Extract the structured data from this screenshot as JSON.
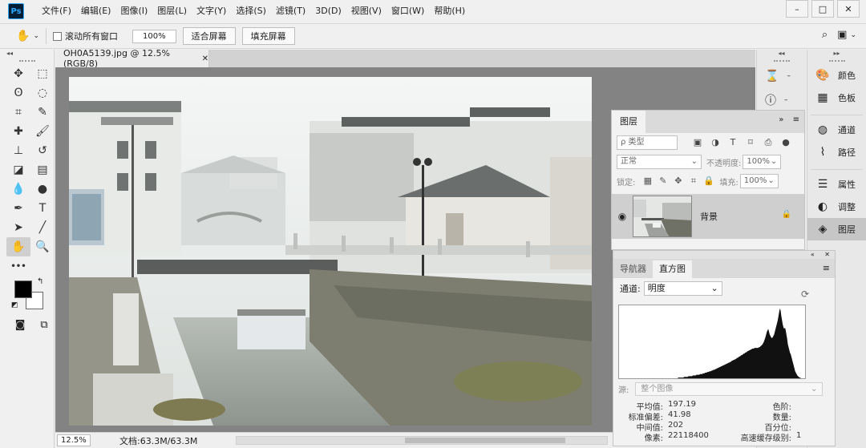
{
  "menubar": {
    "logo": "Ps",
    "items": [
      "文件(F)",
      "编辑(E)",
      "图像(I)",
      "图层(L)",
      "文字(Y)",
      "选择(S)",
      "滤镜(T)",
      "3D(D)",
      "视图(V)",
      "窗口(W)",
      "帮助(H)"
    ],
    "window_controls": [
      "–",
      "□",
      "✕"
    ]
  },
  "options": {
    "scroll_all_label": "滚动所有窗口",
    "zoom_value": "100%",
    "fit_screen_label": "适合屏幕",
    "fill_screen_label": "填充屏幕"
  },
  "document": {
    "tab_title": "OH0A5139.jpg @ 12.5%(RGB/8)",
    "tab_close": "✕",
    "status_zoom": "12.5%",
    "status_docinfo": "文档:63.3M/63.3M"
  },
  "tools": {
    "panel_collapse": "◂◂",
    "items": [
      {
        "name": "move-tool",
        "glyph": "✥"
      },
      {
        "name": "marquee-tool",
        "glyph": "⬚"
      },
      {
        "name": "lasso-tool",
        "glyph": "ʘ"
      },
      {
        "name": "quick-select-tool",
        "glyph": "◌"
      },
      {
        "name": "crop-tool",
        "glyph": "⌗"
      },
      {
        "name": "eyedropper-tool",
        "glyph": "✎"
      },
      {
        "name": "healing-tool",
        "glyph": "✚"
      },
      {
        "name": "brush-tool",
        "glyph": "🖌"
      },
      {
        "name": "stamp-tool",
        "glyph": "⊥"
      },
      {
        "name": "history-brush-tool",
        "glyph": "↺"
      },
      {
        "name": "eraser-tool",
        "glyph": "◪"
      },
      {
        "name": "gradient-tool",
        "glyph": "▤"
      },
      {
        "name": "blur-tool",
        "glyph": "💧"
      },
      {
        "name": "dodge-tool",
        "glyph": "●"
      },
      {
        "name": "pen-tool",
        "glyph": "✒"
      },
      {
        "name": "type-tool",
        "glyph": "T"
      },
      {
        "name": "path-select-tool",
        "glyph": "➤"
      },
      {
        "name": "line-tool",
        "glyph": "╱"
      },
      {
        "name": "hand-tool",
        "glyph": "✋"
      },
      {
        "name": "zoom-tool",
        "glyph": "🔍"
      },
      {
        "name": "more-tools",
        "glyph": "•••"
      },
      {
        "name": "empty-slot",
        "glyph": ""
      }
    ]
  },
  "dock1": {
    "collapse": "◂◂",
    "items": [
      {
        "name": "history-icon",
        "glyph": "⌛"
      },
      {
        "name": "info-icon",
        "glyph": "ⓘ"
      }
    ]
  },
  "dock2": {
    "collapse": "▸▸",
    "items": [
      {
        "name": "color",
        "label": "颜色",
        "glyph": "🎨"
      },
      {
        "name": "swatches",
        "label": "色板",
        "glyph": "▦"
      },
      {
        "name": "channels",
        "label": "通道",
        "glyph": "◍"
      },
      {
        "name": "paths",
        "label": "路径",
        "glyph": "⌇"
      },
      {
        "name": "properties",
        "label": "属性",
        "glyph": "☰"
      },
      {
        "name": "adjustments",
        "label": "调整",
        "glyph": "◐"
      },
      {
        "name": "layers",
        "label": "图层",
        "glyph": "◈"
      }
    ]
  },
  "layers_panel": {
    "tab_label": "图层",
    "filter_placeholder": "ρ 类型",
    "blend_mode": "正常",
    "opacity_label": "不透明度:",
    "opacity_value": "100%",
    "lock_label": "锁定:",
    "fill_label": "填充:",
    "fill_value": "100%",
    "layer_name": "背景"
  },
  "histogram_panel": {
    "tab_navigator": "导航器",
    "tab_histogram": "直方图",
    "channel_label": "通道:",
    "channel_value": "明度",
    "source_label": "源:",
    "source_value": "整个图像",
    "stats": {
      "mean_label": "平均值:",
      "mean_value": "197.19",
      "stddev_label": "标准偏差:",
      "stddev_value": "41.98",
      "median_label": "中间值:",
      "median_value": "202",
      "pixels_label": "像素:",
      "pixels_value": "22118400",
      "level_label": "色阶:",
      "level_value": "",
      "count_label": "数量:",
      "count_value": "",
      "percentile_label": "百分位:",
      "percentile_value": "",
      "cache_label": "高速缓存级别:",
      "cache_value": "1"
    },
    "histogram_bins": [
      0,
      0,
      0,
      0,
      0,
      0,
      0,
      0,
      0,
      0,
      0,
      0,
      0,
      0,
      0,
      0,
      0,
      0,
      0,
      0,
      0,
      0,
      0,
      0,
      0,
      0,
      0,
      0,
      0,
      0,
      0,
      0,
      0,
      0,
      0,
      0,
      0,
      0,
      0,
      0,
      0,
      0,
      0,
      0,
      0,
      0,
      0,
      0,
      0,
      0,
      0,
      0,
      0,
      0,
      0,
      0,
      0,
      0,
      0,
      0,
      0,
      0,
      0,
      0,
      0,
      0,
      0,
      0,
      0,
      0,
      0,
      0,
      0,
      0,
      0,
      0,
      0,
      0,
      0,
      0,
      1,
      1,
      1,
      1,
      1,
      1,
      1,
      1,
      2,
      2,
      2,
      2,
      2,
      2,
      3,
      3,
      3,
      3,
      3,
      3,
      4,
      4,
      4,
      4,
      4,
      5,
      5,
      5,
      5,
      5,
      6,
      6,
      6,
      6,
      7,
      7,
      7,
      8,
      8,
      8,
      9,
      9,
      9,
      10,
      10,
      10,
      11,
      11,
      12,
      12,
      12,
      13,
      13,
      14,
      14,
      15,
      15,
      16,
      16,
      17,
      17,
      18,
      18,
      19,
      19,
      20,
      20,
      21,
      21,
      22,
      22,
      23,
      23,
      24,
      25,
      25,
      26,
      26,
      27,
      27,
      28,
      29,
      29,
      30,
      31,
      31,
      32,
      33,
      33,
      34,
      35,
      35,
      36,
      37,
      37,
      38,
      39,
      39,
      40,
      40,
      41,
      41,
      42,
      42,
      42,
      43,
      43,
      43,
      43,
      43,
      43,
      44,
      44,
      45,
      46,
      47,
      48,
      50,
      52,
      55,
      58,
      62,
      66,
      68,
      70,
      66,
      62,
      60,
      58,
      57,
      58,
      60,
      62,
      66,
      70,
      74,
      78,
      82,
      88,
      94,
      99,
      96,
      88,
      82,
      76,
      72,
      70,
      72,
      68,
      62,
      56,
      48,
      44,
      40,
      36,
      34,
      30,
      26,
      22,
      18,
      14,
      10,
      8,
      6,
      4,
      3,
      2,
      1,
      1,
      0,
      0,
      0,
      0
    ]
  }
}
